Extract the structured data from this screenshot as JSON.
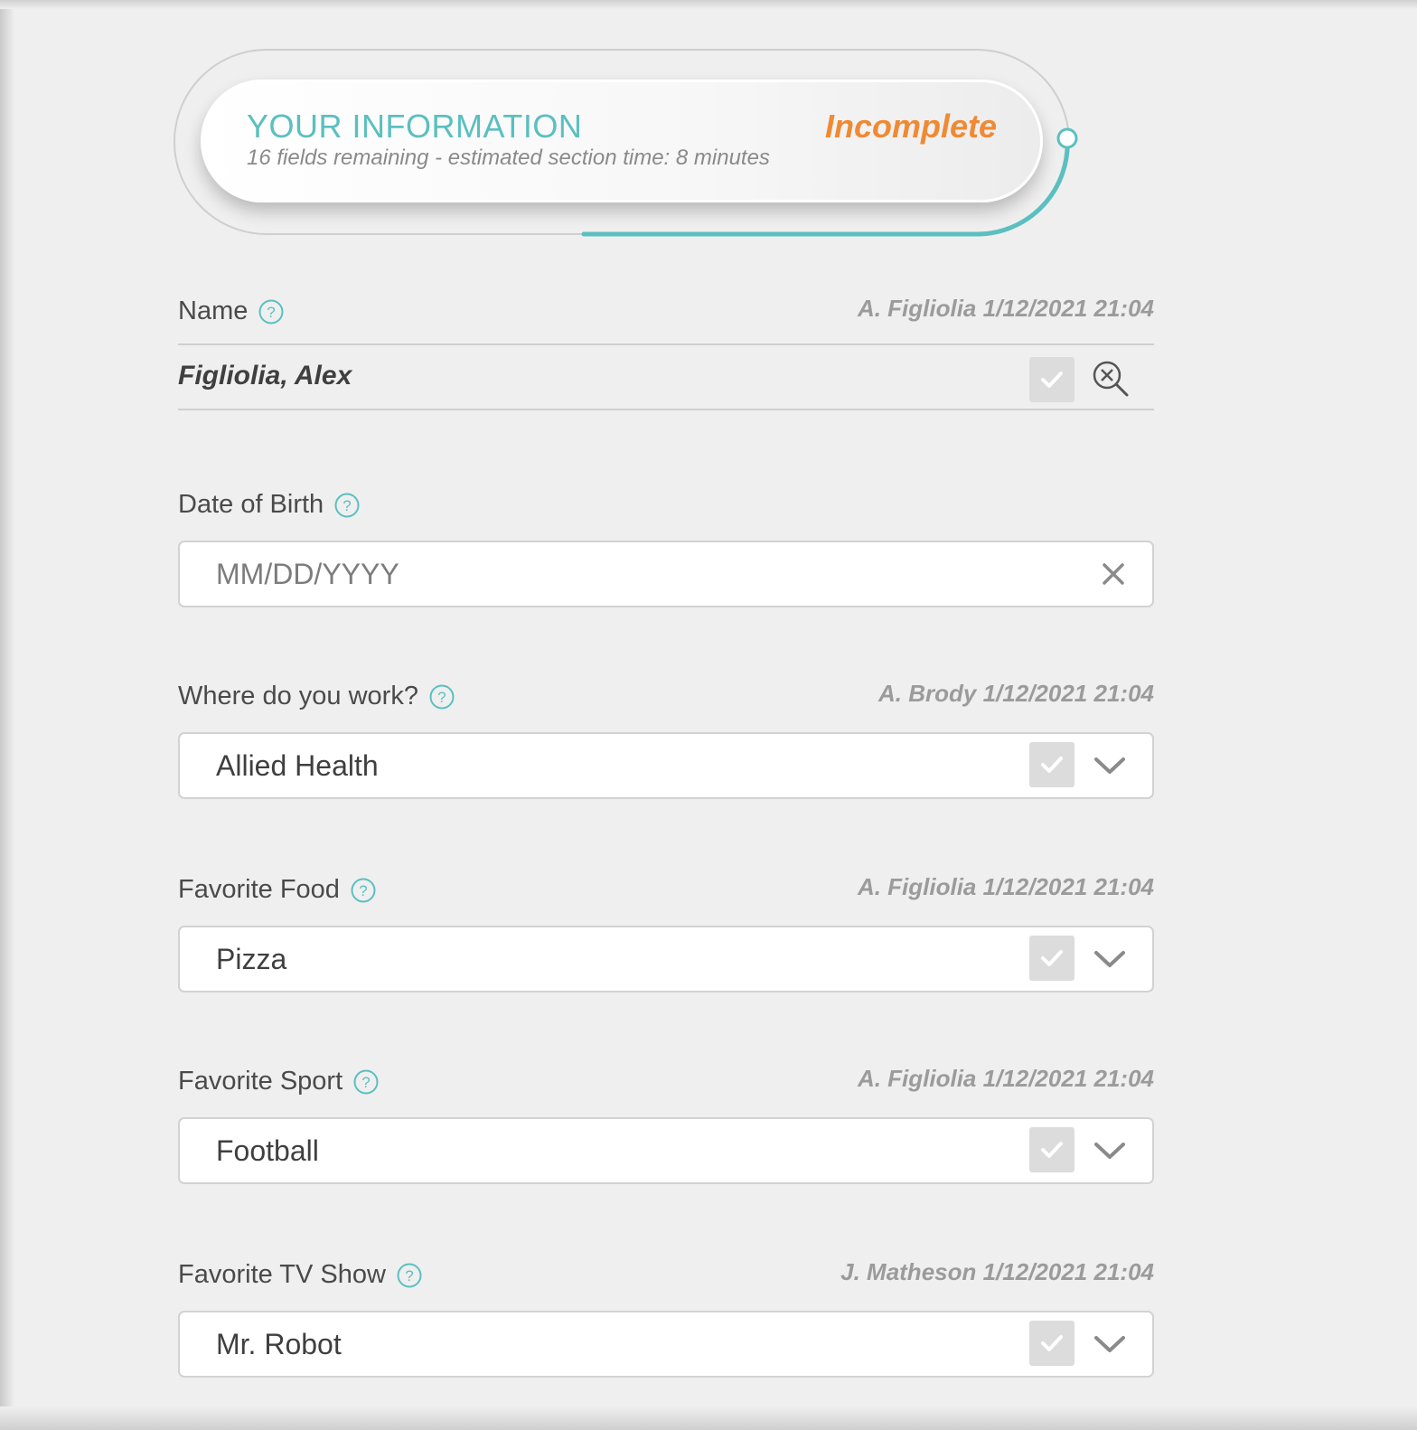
{
  "header": {
    "title": "YOUR INFORMATION",
    "subtitle": "16 fields remaining - estimated section time: 8 minutes",
    "status": "Incomplete",
    "progress_fraction": 0.3,
    "colors": {
      "accent": "#5bbfc0",
      "status": "#ef8a34"
    }
  },
  "fields": {
    "name": {
      "label": "Name",
      "meta": "A. Figliolia 1/12/2021 21:04",
      "value": "Figliolia, Alex"
    },
    "dob": {
      "label": "Date of Birth",
      "placeholder": "MM/DD/YYYY",
      "value": ""
    },
    "work": {
      "label": "Where do you work?",
      "meta": "A. Brody 1/12/2021 21:04",
      "value": "Allied Health"
    },
    "food": {
      "label": "Favorite Food",
      "meta": "A. Figliolia 1/12/2021 21:04",
      "value": "Pizza"
    },
    "sport": {
      "label": "Favorite Sport",
      "meta": "A. Figliolia 1/12/2021 21:04",
      "value": "Football"
    },
    "tv": {
      "label": "Favorite TV Show",
      "meta": "J. Matheson 1/12/2021 21:04",
      "value": "Mr. Robot"
    }
  },
  "icons": {
    "help": "question-circle-icon",
    "lookup": "search-clear-icon",
    "clear": "close-icon",
    "dropdown": "chevron-down-icon",
    "confirm": "checkmark-icon"
  }
}
